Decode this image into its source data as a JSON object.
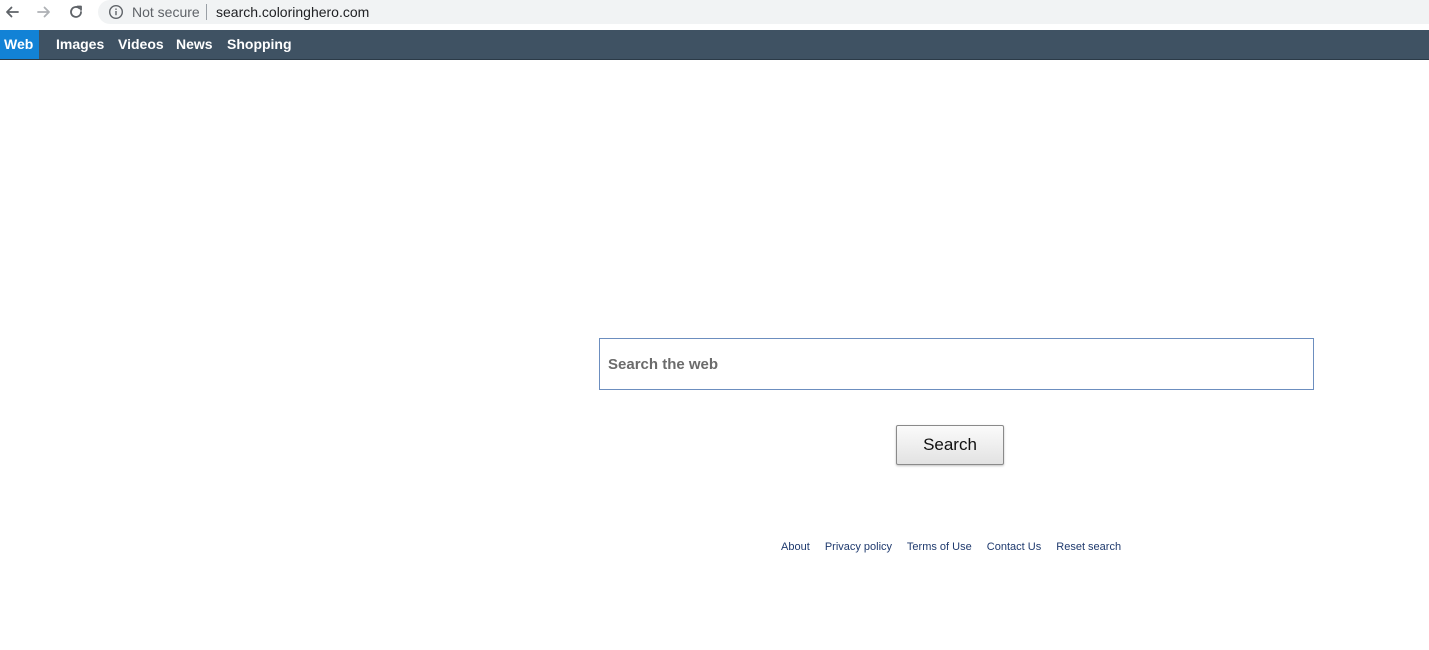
{
  "browser": {
    "security_label": "Not secure",
    "url": "search.coloringhero.com"
  },
  "nav_tabs": [
    {
      "label": "Web",
      "active": true
    },
    {
      "label": "Images",
      "active": false
    },
    {
      "label": "Videos",
      "active": false
    },
    {
      "label": "News",
      "active": false
    },
    {
      "label": "Shopping",
      "active": false
    }
  ],
  "search": {
    "placeholder": "Search the web",
    "value": "",
    "button_label": "Search"
  },
  "footer": {
    "links": [
      "About",
      "Privacy policy",
      "Terms of Use",
      "Contact Us",
      "Reset search"
    ]
  },
  "colors": {
    "nav_bar_bg": "#3f5263",
    "active_tab_bg": "#1282d6",
    "link_color": "#1f3a6e"
  },
  "icons": {
    "back": "arrow-left-icon",
    "forward": "arrow-right-icon",
    "reload": "reload-icon",
    "info": "info-icon"
  }
}
